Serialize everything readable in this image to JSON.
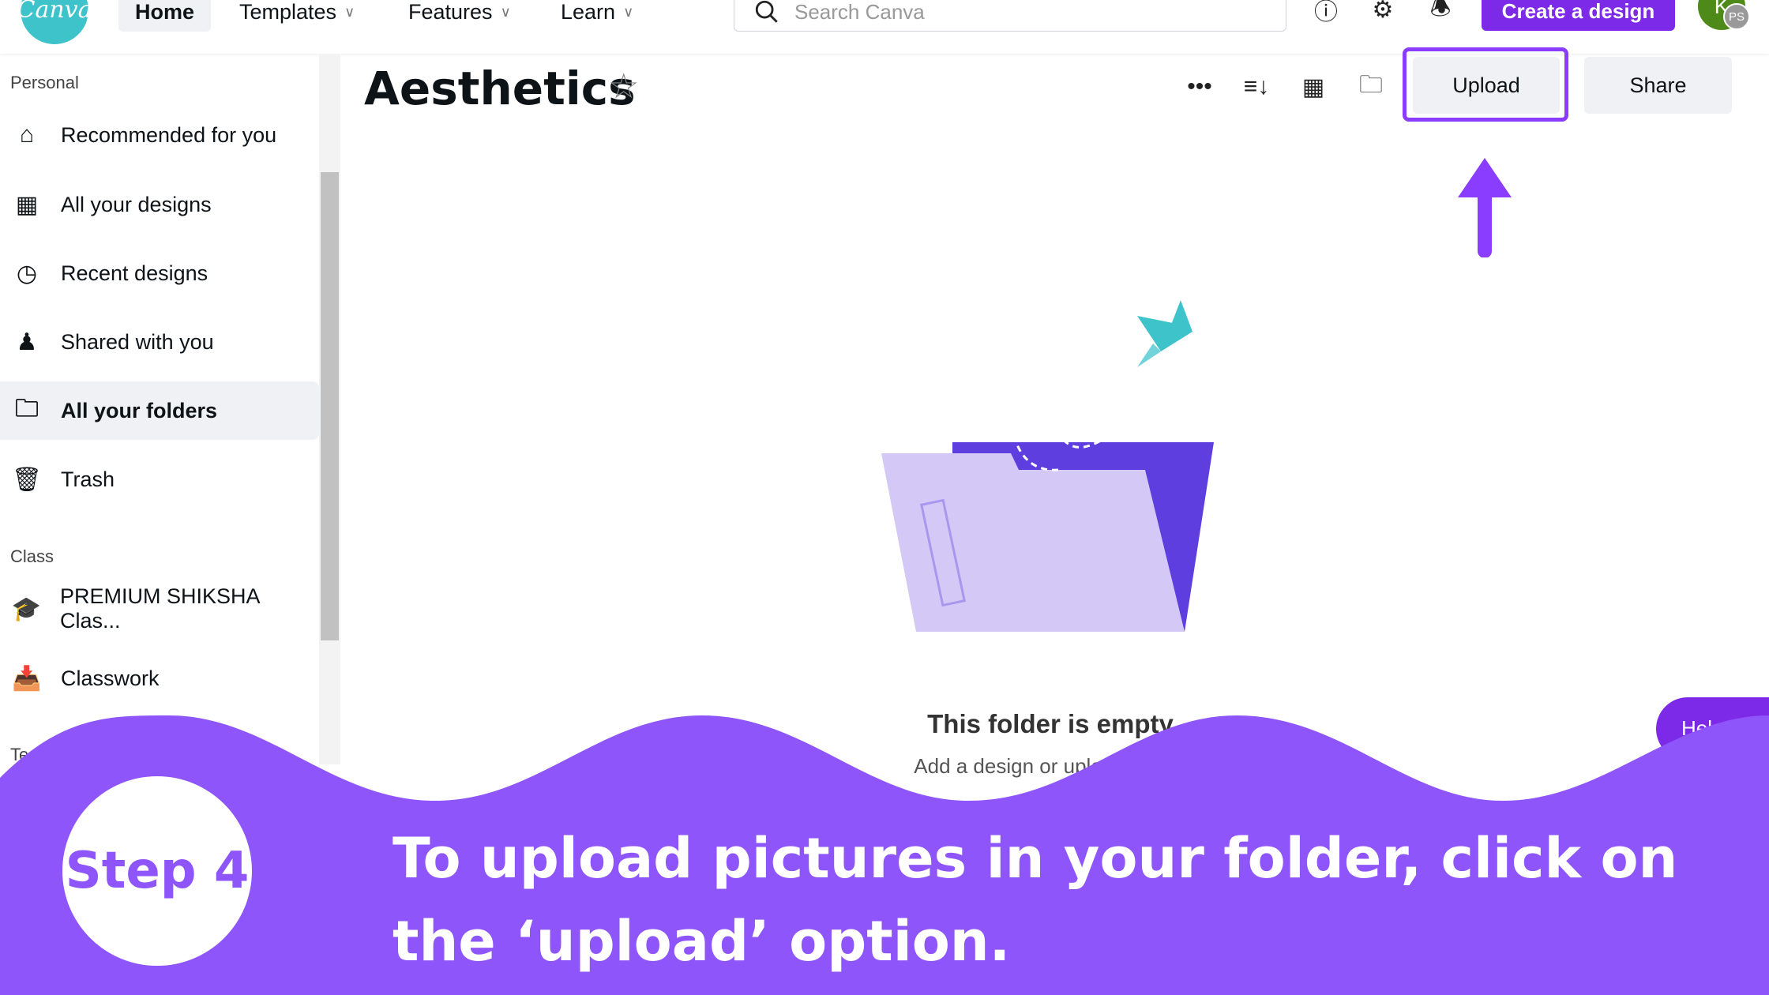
{
  "topbar": {
    "logo": "Canva",
    "nav": [
      {
        "label": "Home"
      },
      {
        "label": "Templates"
      },
      {
        "label": "Features"
      },
      {
        "label": "Learn"
      }
    ],
    "search_placeholder": "Search Canva",
    "create_label": "Create a design",
    "avatar_initial": "K",
    "avatar_secondary": "PS"
  },
  "sidebar": {
    "personal_label": "Personal",
    "items": [
      {
        "label": "Recommended for you",
        "icon": "home-icon"
      },
      {
        "label": "All your designs",
        "icon": "grid-icon"
      },
      {
        "label": "Recent designs",
        "icon": "clock-icon"
      },
      {
        "label": "Shared with you",
        "icon": "people-icon"
      },
      {
        "label": "All your folders",
        "icon": "folder-icon",
        "active": true
      },
      {
        "label": "Trash",
        "icon": "trash-icon"
      }
    ],
    "class_label": "Class",
    "class_items": [
      {
        "label": "PREMIUM SHIKSHA Clas...",
        "icon": "graduation-cap-icon"
      },
      {
        "label": "Classwork",
        "icon": "inbox-icon"
      }
    ],
    "team_label_partial": "Te"
  },
  "main": {
    "title": "Aesthetics",
    "upload_label": "Upload",
    "share_label": "Share",
    "empty_title": "This folder is empty",
    "empty_sub": "Add a design or upload media",
    "help_label": "Help"
  },
  "overlay": {
    "step_label": "Step 4",
    "instruction": "To upload pictures in your folder, click on the ‘upload’ option.",
    "accent": "#8e55fb"
  }
}
